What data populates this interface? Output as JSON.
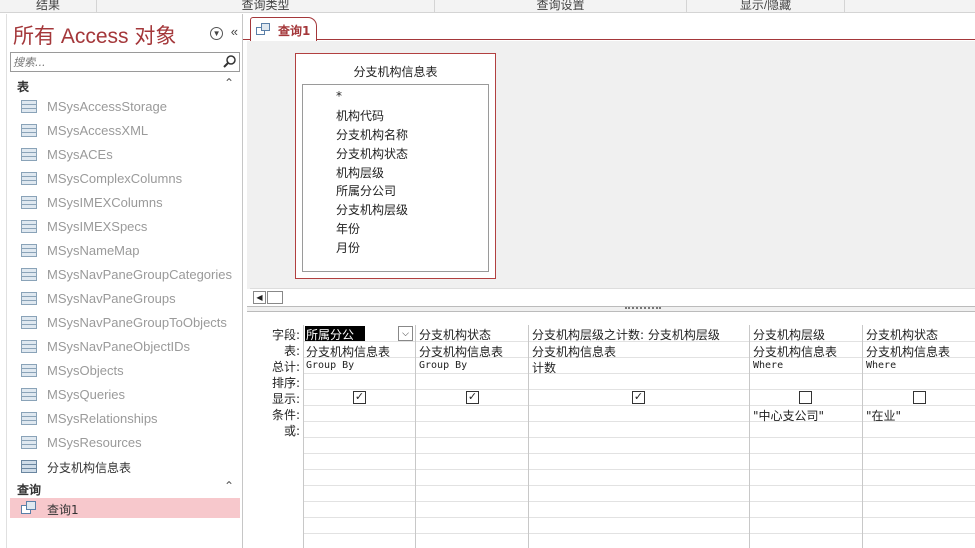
{
  "ribbon": {
    "groups": [
      "结果",
      "查询类型",
      "查询设置",
      "显示/隐藏"
    ]
  },
  "nav": {
    "title": "所有 Access 对象",
    "search_placeholder": "搜索...",
    "sections": [
      {
        "label": "表",
        "items": [
          {
            "label": "MSysAccessStorage",
            "system": true
          },
          {
            "label": "MSysAccessXML",
            "system": true
          },
          {
            "label": "MSysACEs",
            "system": true
          },
          {
            "label": "MSysComplexColumns",
            "system": true
          },
          {
            "label": "MSysIMEXColumns",
            "system": true
          },
          {
            "label": "MSysIMEXSpecs",
            "system": true
          },
          {
            "label": "MSysNameMap",
            "system": true
          },
          {
            "label": "MSysNavPaneGroupCategories",
            "system": true
          },
          {
            "label": "MSysNavPaneGroups",
            "system": true
          },
          {
            "label": "MSysNavPaneGroupToObjects",
            "system": true
          },
          {
            "label": "MSysNavPaneObjectIDs",
            "system": true
          },
          {
            "label": "MSysObjects",
            "system": true
          },
          {
            "label": "MSysQueries",
            "system": true
          },
          {
            "label": "MSysRelationships",
            "system": true
          },
          {
            "label": "MSysResources",
            "system": true
          },
          {
            "label": "分支机构信息表",
            "system": false
          }
        ]
      },
      {
        "label": "查询",
        "items": [
          {
            "label": "查询1",
            "selected": true
          }
        ]
      }
    ]
  },
  "tab": {
    "label": "查询1"
  },
  "table_box": {
    "title": "分支机构信息表",
    "fields": [
      "*",
      "机构代码",
      "分支机构名称",
      "分支机构状态",
      "机构层级",
      "所属分公司",
      "分支机构层级",
      "年份",
      "月份"
    ]
  },
  "grid": {
    "row_labels": [
      "字段:",
      "表:",
      "总计:",
      "排序:",
      "显示:",
      "条件:",
      "或:"
    ],
    "columns": [
      {
        "field": "所属分公司",
        "table": "分支机构信息表",
        "total": "Group By",
        "sort": "",
        "show": true,
        "criteria": ""
      },
      {
        "field": "分支机构状态",
        "table": "分支机构信息表",
        "total": "Group By",
        "sort": "",
        "show": true,
        "criteria": ""
      },
      {
        "field": "分支机构层级之计数: 分支机构层级",
        "table": "分支机构信息表",
        "total": "计数",
        "sort": "",
        "show": true,
        "criteria": ""
      },
      {
        "field": "分支机构层级",
        "table": "分支机构信息表",
        "total": "Where",
        "sort": "",
        "show": false,
        "criteria": "\"中心支公司\""
      },
      {
        "field": "分支机构状态",
        "table": "分支机构信息表",
        "total": "Where",
        "sort": "",
        "show": false,
        "criteria": "\"在业\""
      }
    ]
  },
  "icons": {
    "nav_menu": "circle-chevron-down-icon",
    "nav_collapse": "double-chevron-left-icon",
    "search": "search-icon",
    "section_collapse": "double-chevron-up-icon",
    "checkmark": "checkmark-icon"
  }
}
